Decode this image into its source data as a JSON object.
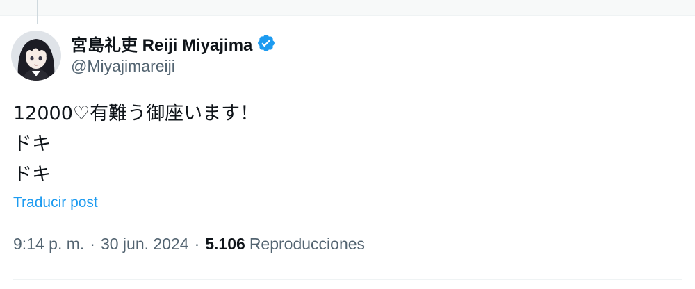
{
  "author": {
    "display_name": "宮島礼吏 Reiji Miyajima",
    "handle": "@Miyajimareiji",
    "verified": true,
    "avatar_icon": "anime-girl-avatar",
    "verified_color": "#1d9bf0"
  },
  "tweet": {
    "lines": [
      "12000♡有難う御座います！",
      "ドキ",
      "ドキ"
    ]
  },
  "translate_label": "Traducir post",
  "meta": {
    "time": "9:14 p. m.",
    "separator": "·",
    "date": "30 jun. 2024",
    "views_count": "5.106",
    "views_label": "Reproducciones"
  }
}
